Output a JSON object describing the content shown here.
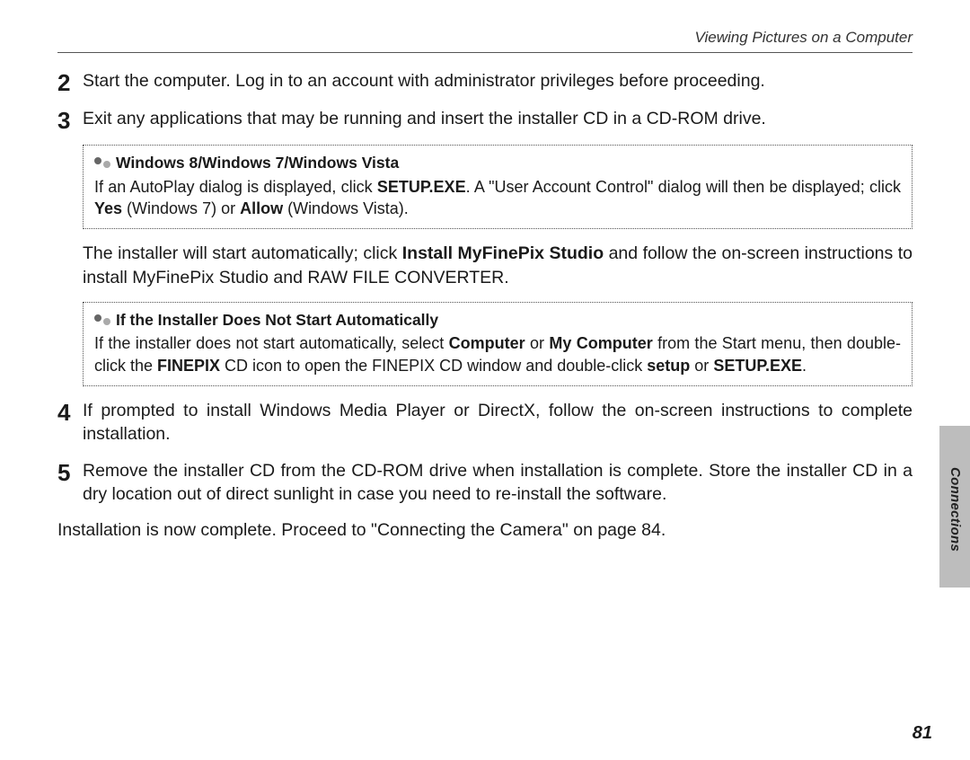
{
  "header": {
    "running_title": "Viewing Pictures on a Computer"
  },
  "steps": {
    "s2_num": "2",
    "s2_text": "Start the computer.  Log in to an account with administrator privileges before proceeding.",
    "s3_num": "3",
    "s3_text": "Exit any applications that may be running and insert the installer CD in a CD-ROM drive.",
    "s4_num": "4",
    "s4_text": "If prompted to install Windows Media Player or DirectX, follow the on-screen instructions to complete installation.",
    "s5_num": "5",
    "s5_text": "Remove the installer CD from the CD-ROM drive when installation is complete.  Store the installer CD in a dry location out of direct sunlight in case you need to re-install the software."
  },
  "box1": {
    "title": "Windows 8/Windows 7/Windows Vista",
    "pre1": "If an AutoPlay dialog is displayed, click ",
    "b1": "SETUP.EXE",
    "mid1": ".  A \"User Account Control\" dialog will then be displayed; click ",
    "b2": "Yes",
    "mid2": " (Windows 7) or ",
    "b3": "Allow",
    "post": " (Windows Vista)."
  },
  "para_install": {
    "pre": "The installer will start automatically; click ",
    "b1": "Install MyFinePix Studio",
    "post": " and follow the on-screen instructions to install MyFinePix Studio and RAW FILE CONVERTER."
  },
  "box2": {
    "title": "If the Installer Does Not Start Automatically",
    "pre1": "If the installer does not start automatically, select ",
    "b1": "Computer",
    "mid1": " or ",
    "b2": "My Computer",
    "mid2": " from the Start menu, then double-click the ",
    "b3": "FINEPIX",
    "mid3": " CD icon to open the FINEPIX CD window and double-click ",
    "b4": "setup",
    "mid4": " or ",
    "b5": "SETUP.EXE",
    "post": "."
  },
  "closing": "Installation is now complete.  Proceed to \"Connecting the Camera\" on page 84.",
  "side": {
    "label": "Connections"
  },
  "page_number": "81"
}
